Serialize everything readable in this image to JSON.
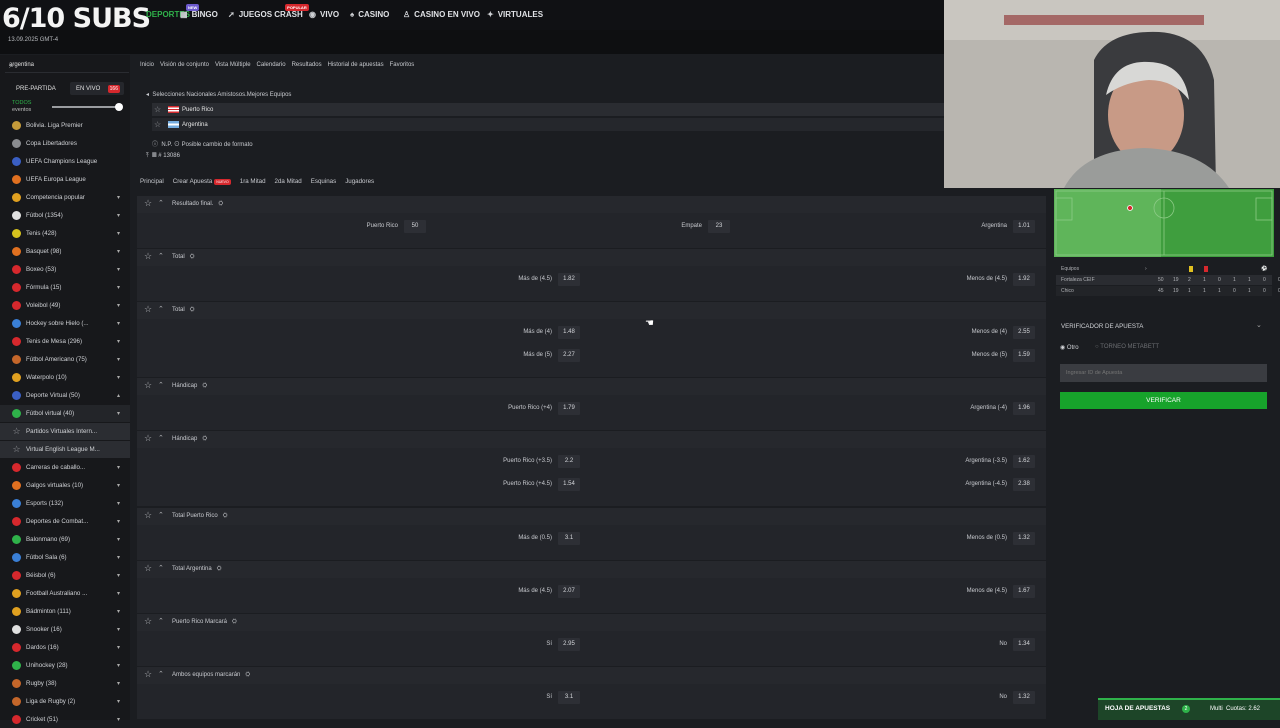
{
  "overlay": {
    "subs": "6/10 SUBS",
    "date": "13.09.2025 GMT-4"
  },
  "nav": {
    "items": [
      {
        "label": "DEPORTES",
        "active": true
      },
      {
        "label": "BINGO",
        "badge": "NEW"
      },
      {
        "label": "JUEGOS CRASH",
        "badge": "POPULAR"
      },
      {
        "label": "VIVO"
      },
      {
        "label": "CASINO"
      },
      {
        "label": "CASINO EN VIVO"
      },
      {
        "label": "VIRTUALES"
      }
    ]
  },
  "sidebar": {
    "search_value": "argentina",
    "pre_tab": "PRE-PARTIDA",
    "live_tab": "EN VIVO",
    "live_count": "166",
    "todos": "TODOS",
    "eventos": "eventos",
    "items": [
      {
        "label": "Bolivia. Liga Premier",
        "icon": "trophy-icon",
        "color": "#c49a3a"
      },
      {
        "label": "Copa Libertadores",
        "icon": "trophy-icon",
        "color": "#8a8c90"
      },
      {
        "label": "UEFA Champions League",
        "icon": "champions-icon",
        "color": "#3a5fc4"
      },
      {
        "label": "UEFA Europa League",
        "icon": "europa-icon",
        "color": "#e07020"
      },
      {
        "label": "Competencia popular",
        "icon": "star-icon",
        "color": "#e0a020",
        "chev": "▾"
      },
      {
        "label": "Fútbol (1354)",
        "icon": "soccer-icon",
        "color": "#e0e0e0",
        "chev": "▾"
      },
      {
        "label": "Tenis (428)",
        "icon": "tennis-icon",
        "color": "#d6c21e",
        "chev": "▾"
      },
      {
        "label": "Basquet (98)",
        "icon": "basketball-icon",
        "color": "#e07020",
        "chev": "▾"
      },
      {
        "label": "Boxeo (53)",
        "icon": "boxing-icon",
        "color": "#d6282d",
        "chev": "▾"
      },
      {
        "label": "Fórmula (15)",
        "icon": "formula-icon",
        "color": "#d6282d",
        "chev": "▾"
      },
      {
        "label": "Voleibol (49)",
        "icon": "volleyball-icon",
        "color": "#d6282d",
        "chev": "▾"
      },
      {
        "label": "Hockey sobre Hielo (...",
        "icon": "hockey-icon",
        "color": "#3a7fd6",
        "chev": "▾"
      },
      {
        "label": "Tenis de Mesa (296)",
        "icon": "table-tennis-icon",
        "color": "#d6282d",
        "chev": "▾"
      },
      {
        "label": "Fútbol Americano (75)",
        "icon": "football-icon",
        "color": "#c4662a",
        "chev": "▾"
      },
      {
        "label": "Waterpolo (10)",
        "icon": "waterpolo-icon",
        "color": "#e0a020",
        "chev": "▾"
      },
      {
        "label": "Deporte Virtual (50)",
        "icon": "virtual-icon",
        "color": "#3a5fc4",
        "chev": "▴"
      },
      {
        "label": "Fútbol virtual (40)",
        "icon": "virtual-soccer-icon",
        "color": "#2fb24a",
        "chev": "▾",
        "sel": true
      },
      {
        "label": "Partidos Virtuales Intern...",
        "icon": "star-outline-icon",
        "color": "#9c9ea3",
        "hl": true
      },
      {
        "label": "Virtual English League M...",
        "icon": "star-outline-icon",
        "color": "#9c9ea3",
        "hl": true
      },
      {
        "label": "Carreras de caballo...",
        "icon": "horse-icon",
        "color": "#d6282d",
        "chev": "▾"
      },
      {
        "label": "Galgos virtuales (10)",
        "icon": "dog-icon",
        "color": "#e07020",
        "chev": "▾"
      },
      {
        "label": "Esports (132)",
        "icon": "esports-icon",
        "color": "#3a7fd6",
        "chev": "▾"
      },
      {
        "label": "Deportes de Combat...",
        "icon": "combat-icon",
        "color": "#d6282d",
        "chev": "▾"
      },
      {
        "label": "Balonmano (69)",
        "icon": "handball-icon",
        "color": "#2fb24a",
        "chev": "▾"
      },
      {
        "label": "Fútbol Sala (6)",
        "icon": "futsal-icon",
        "color": "#3a7fd6",
        "chev": "▾"
      },
      {
        "label": "Béisbol (6)",
        "icon": "baseball-icon",
        "color": "#d6282d",
        "chev": "▾"
      },
      {
        "label": "Football Australiano ...",
        "icon": "aussie-football-icon",
        "color": "#e0a020",
        "chev": "▾"
      },
      {
        "label": "Bádminton (111)",
        "icon": "badminton-icon",
        "color": "#e0a020",
        "chev": "▾"
      },
      {
        "label": "Snooker (16)",
        "icon": "snooker-icon",
        "color": "#e0e0e0",
        "chev": "▾"
      },
      {
        "label": "Dardos (16)",
        "icon": "darts-icon",
        "color": "#d6282d",
        "chev": "▾"
      },
      {
        "label": "Unihockey (28)",
        "icon": "unihockey-icon",
        "color": "#2fb24a",
        "chev": "▾"
      },
      {
        "label": "Rugby (38)",
        "icon": "rugby-icon",
        "color": "#c4662a",
        "chev": "▾"
      },
      {
        "label": "Liga de Rugby (2)",
        "icon": "rugby-league-icon",
        "color": "#c4662a",
        "chev": "▾"
      },
      {
        "label": "Cricket (51)",
        "icon": "cricket-icon",
        "color": "#d6282d",
        "chev": "▾"
      }
    ]
  },
  "breadcrumb": [
    "Inicio",
    "Visión de conjunto",
    "Vista Múltiple",
    "Calendario",
    "Resultados",
    "Historial de apuestas",
    "Favoritos"
  ],
  "event": {
    "title": "Selecciones Nacionales Amistosos.Mejores Equipos",
    "home": "Puerto Rico",
    "away": "Argentina",
    "np": "N.P. ⊙ Posible cambio de formato",
    "id": "# 13086"
  },
  "market_tabs": [
    "Principal",
    "Crear Apuesta",
    "1ra Mitad",
    "2da Mitad",
    "Esquinas",
    "Jugadores"
  ],
  "new_badge": "NUEVO",
  "markets": [
    {
      "title": "Resultado final.",
      "rows": [
        [
          [
            "Puerto Rico",
            "50"
          ],
          [
            "Empate",
            "23"
          ],
          [
            "Argentina",
            "1.01"
          ]
        ]
      ]
    },
    {
      "title": "Total",
      "rows": [
        [
          [
            "Más de (4.5)",
            "1.82"
          ],
          [
            "Menos de (4.5)",
            "1.92"
          ]
        ]
      ]
    },
    {
      "title": "Total",
      "rows": [
        [
          [
            "Más de (4)",
            "1.48"
          ],
          [
            "Menos de (4)",
            "2.55"
          ]
        ],
        [
          [
            "Más de (5)",
            "2.27"
          ],
          [
            "Menos de (5)",
            "1.59"
          ]
        ]
      ]
    },
    {
      "title": "Hándicap",
      "rows": [
        [
          [
            "Puerto Rico (+4)",
            "1.79"
          ],
          [
            "Argentina (-4)",
            "1.96"
          ]
        ]
      ]
    },
    {
      "title": "Hándicap",
      "rows": [
        [
          [
            "Puerto Rico (+3.5)",
            "2.2"
          ],
          [
            "Argentina (-3.5)",
            "1.62"
          ]
        ],
        [
          [
            "Puerto Rico (+4.5)",
            "1.54"
          ],
          [
            "Argentina (-4.5)",
            "2.38"
          ]
        ]
      ]
    },
    {
      "title": "Total Puerto Rico",
      "rows": [
        [
          [
            "Más de (0.5)",
            "3.1"
          ],
          [
            "Menos de (0.5)",
            "1.32"
          ]
        ]
      ]
    },
    {
      "title": "Total Argentina",
      "rows": [
        [
          [
            "Más de (4.5)",
            "2.07"
          ],
          [
            "Menos de (4.5)",
            "1.67"
          ]
        ]
      ]
    },
    {
      "title": "Puerto Rico Marcará",
      "rows": [
        [
          [
            "Sí",
            "2.95"
          ],
          [
            "No",
            "1.34"
          ]
        ]
      ]
    },
    {
      "title": "Ambos equipos marcarán",
      "rows": [
        [
          [
            "Sí",
            "3.1"
          ],
          [
            "No",
            "1.32"
          ]
        ]
      ]
    }
  ],
  "scoreboard": {
    "header": "Equipos",
    "rows": [
      {
        "team": "Fortaleza CEIF",
        "vals": [
          "50",
          "19",
          "2",
          "1",
          "0",
          "1",
          "1",
          "0",
          "0"
        ]
      },
      {
        "team": "Chico",
        "vals": [
          "45",
          "19",
          "1",
          "1",
          "1",
          "0",
          "1",
          "0",
          "0"
        ]
      }
    ]
  },
  "verifier": {
    "title": "VERIFICADOR DE APUESTA",
    "opt1": "Otro",
    "opt2": "TORNEO METABETT",
    "placeholder": "Ingresar ID de Apuesta",
    "button": "VERIFICAR"
  },
  "betslip": {
    "label": "HOJA DE APUESTAS",
    "count": "2",
    "mode": "Multi",
    "odds": "Cuotas: 2.62"
  },
  "colors": {
    "accent": "#2fb24a",
    "live": "#d6282d"
  }
}
